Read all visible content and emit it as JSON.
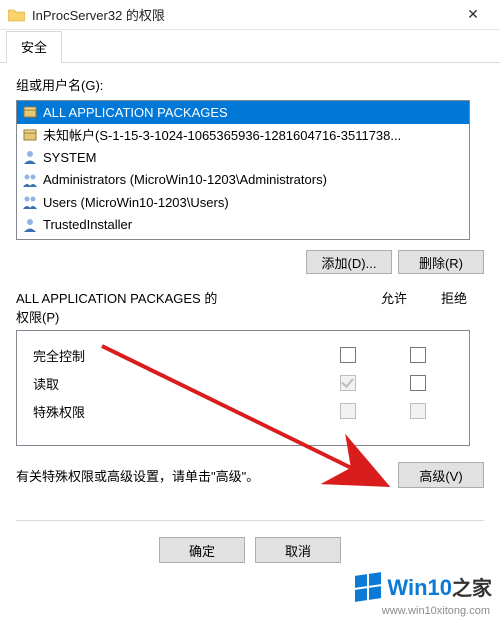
{
  "title": "InProcServer32 的权限",
  "tab": "安全",
  "groups_label": "组或用户名(G):",
  "groups": [
    {
      "name": "ALL APPLICATION PACKAGES",
      "icon": "pkg",
      "selected": true
    },
    {
      "name": "未知帐户(S-1-15-3-1024-1065365936-1281604716-3511738...",
      "icon": "pkg",
      "selected": false
    },
    {
      "name": "SYSTEM",
      "icon": "user",
      "selected": false
    },
    {
      "name": "Administrators (MicroWin10-1203\\Administrators)",
      "icon": "group",
      "selected": false
    },
    {
      "name": "Users (MicroWin10-1203\\Users)",
      "icon": "group",
      "selected": false
    },
    {
      "name": "TrustedInstaller",
      "icon": "user",
      "selected": false
    }
  ],
  "buttons": {
    "add": "添加(D)...",
    "remove": "删除(R)",
    "advanced": "高级(V)",
    "ok": "确定",
    "cancel": "取消"
  },
  "perm_label_line1": "ALL APPLICATION PACKAGES 的",
  "perm_label_line2": "权限(P)",
  "perm_cols": {
    "allow": "允许",
    "deny": "拒绝"
  },
  "perms": [
    {
      "name": "完全控制",
      "allow": "unchecked",
      "deny": "unchecked"
    },
    {
      "name": "读取",
      "allow": "checked-disabled",
      "deny": "unchecked"
    },
    {
      "name": "特殊权限",
      "allow": "disabled",
      "deny": "disabled"
    }
  ],
  "adv_text": "有关特殊权限或高级设置，请单击\"高级\"。",
  "watermark": {
    "brand_a": "Win10",
    "brand_b": "之家",
    "url": "www.win10xitong.com"
  },
  "colors": {
    "accent": "#0078d7",
    "wm": "#0b7ad6"
  }
}
